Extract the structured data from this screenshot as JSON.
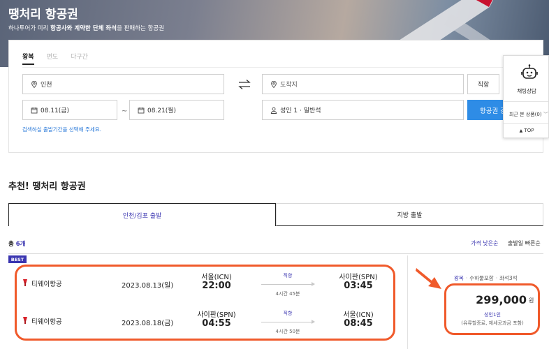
{
  "hero": {
    "title": "땡처리 항공권",
    "subtitle_pre": "하나투어가 미리 ",
    "subtitle_bold": "항공사와 계약한 단체 좌석",
    "subtitle_post": "을 판매하는 항공권"
  },
  "search": {
    "tabs": [
      "왕복",
      "편도",
      "다구간"
    ],
    "departure": "인천",
    "arrival_placeholder": "도착지",
    "direct_label": "직항",
    "date_start": "08.11(금)",
    "date_sep": "~",
    "date_end": "08.21(월)",
    "passengers": "성인 1 · 일반석",
    "search_button": "항공권 검색",
    "hint": "검색하실 출발기간을 선택해 주세요."
  },
  "widget": {
    "chat_label": "채팅상담",
    "recent_label": "최근 본 상품(0)",
    "top_label": "TOP"
  },
  "section": {
    "title": "추천! 땡처리 항공권",
    "tabs": [
      "인천/김포 출발",
      "지방 출발"
    ],
    "total_prefix": "총 ",
    "total_count": "6개",
    "sort_price": "가격 낮은순",
    "sort_departure": "출발일 빠른순"
  },
  "result": {
    "badge": "BEST",
    "legs": [
      {
        "airline": "티웨이항공",
        "date": "2023.08.13(일)",
        "from_city": "서울(ICN)",
        "from_time": "22:00",
        "direct": "직항",
        "duration": "4시간 45분",
        "to_city": "사이판(SPN)",
        "to_time": "03:45"
      },
      {
        "airline": "티웨이항공",
        "date": "2023.08.18(금)",
        "from_city": "사이판(SPN)",
        "from_time": "04:55",
        "direct": "직항",
        "duration": "4시간 50분",
        "to_city": "서울(ICN)",
        "to_time": "08:45"
      }
    ],
    "tags": [
      "왕복",
      "수하물포함",
      "좌석3석"
    ],
    "price": "299,000",
    "currency": "원",
    "per_person": "성인1인",
    "tax_note": "(유류할증료, 제세공과금 포함)"
  },
  "colors": {
    "accent": "#3a35b0",
    "highlight": "#f05a2b",
    "search_button": "#2e8ce6",
    "airline_logo": "#d8222a"
  }
}
